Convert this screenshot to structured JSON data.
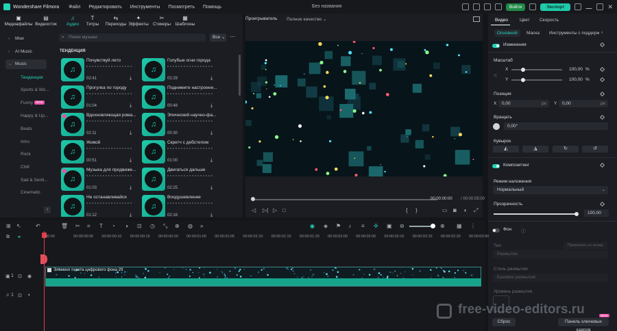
{
  "titlebar": {
    "app_name": "Wondershare Filmora",
    "menu": [
      "Файл",
      "Редактировать",
      "Инструменты",
      "Посмотреть",
      "Помощь"
    ],
    "project_title": "Без названия",
    "save_label": "Войти",
    "export_label": "Экспорт"
  },
  "media_tabs": [
    {
      "label": "Медиафайлы",
      "icon": "folder-icon",
      "glyph": "▣"
    },
    {
      "label": "Видеосток",
      "icon": "video-stock-icon",
      "glyph": "▤"
    },
    {
      "label": "Аудио",
      "icon": "music-note-icon",
      "glyph": "♫"
    },
    {
      "label": "Титры",
      "icon": "text-icon",
      "glyph": "T"
    },
    {
      "label": "Переходы",
      "icon": "transition-icon",
      "glyph": "⇆"
    },
    {
      "label": "Эффекты",
      "icon": "effects-icon",
      "glyph": "✦"
    },
    {
      "label": "Стикеры",
      "icon": "sticker-icon",
      "glyph": "✂"
    },
    {
      "label": "Шаблоны",
      "icon": "templates-icon",
      "glyph": "▦"
    }
  ],
  "categories": {
    "top": [
      "Мои",
      "AI Music",
      "Music"
    ],
    "sub": [
      "Тенденция",
      "Sports & Wo...",
      "Funny",
      "Happy & Up...",
      "Beats",
      "Intro",
      "Rock",
      "Chill",
      "Sad & Senti...",
      "Cinematic"
    ],
    "funny_badge": "NEW"
  },
  "search": {
    "placeholder": "Поиск музыки",
    "filter": "Все"
  },
  "section_title": "ТЕНДЕНЦИЯ",
  "tracks": [
    {
      "name": "Почувствуй лето",
      "duration": "02:41"
    },
    {
      "name": "Голубые огни города",
      "duration": "02:29"
    },
    {
      "name": "Прогулка по городу",
      "duration": "01:04"
    },
    {
      "name": "Поднимите настроени...",
      "duration": "00:48"
    },
    {
      "name": "Вдохновляющая рома...",
      "duration": "02:11"
    },
    {
      "name": "Эпический научно-фа...",
      "duration": "00:30"
    },
    {
      "name": "Живой",
      "duration": "00:51"
    },
    {
      "name": "Скретч с дебстепом",
      "duration": "01:00"
    },
    {
      "name": "Музыка для продвиже...",
      "duration": "01:03"
    },
    {
      "name": "Двигаться дальше",
      "duration": "02:25"
    },
    {
      "name": "Не останавливайся",
      "duration": "01:12"
    },
    {
      "name": "Воодушевление",
      "duration": "02:16"
    }
  ],
  "player": {
    "label": "Проигрыватель",
    "quality": "Полное качество",
    "current_time": "00:00:00:00",
    "total_time": "/ 00:00:05:00"
  },
  "right": {
    "tabs": [
      "Видео",
      "Цвет",
      "Скорость"
    ],
    "subtabs": [
      "Основной",
      "Маска",
      "Инструменты с поддержко"
    ],
    "transform": "Изменения",
    "scale": "Масштаб",
    "scale_x": "100,00",
    "scale_y": "100,00",
    "percent": "%",
    "position": "Позиция",
    "pos_x": "0,00",
    "pos_y": "0,00",
    "px": "px",
    "rotate": "Вращать",
    "rotate_val": "0,00°",
    "flip": "Кувырок",
    "compositing": "Композитинг",
    "blend_mode": "Режим наложения",
    "blend_val": "Нормальный",
    "opacity": "Прозрачность",
    "opacity_val": "100,00",
    "background": "Фон",
    "type": "Тип",
    "apply_all": "Применить ко всему",
    "blur_type": "Размытие",
    "blur_style": "Стиль размытия",
    "blur_style_val": "Базовое размытие",
    "blur_level": "Уровень размытия",
    "reset": "Сброс",
    "keyframe_panel": "Панель ключевых кадров",
    "new_badge": "NEW"
  },
  "timeline": {
    "ruler": [
      "00:00",
      "00:00:00:05",
      "00:00:00:10",
      "00:00:00:15",
      "00:00:00:20",
      "00:00:01:00",
      "00:00:01:05",
      "00:00:01:10",
      "00:00:01:15",
      "00:00:01:20",
      "00:00:02:00",
      "00:00:02:05",
      "00:00:02:10",
      "00:00:02:15",
      "00:00:02:20",
      "00:00:03:00"
    ],
    "clip_label": "Элемент пакета цифрового фона 29",
    "video_track": "1",
    "audio_track": "1"
  },
  "watermark": "free-video-editors.ru",
  "colors": {
    "accent": "#22d3b6",
    "playhead": "#e53c4b",
    "background": "#141519"
  }
}
